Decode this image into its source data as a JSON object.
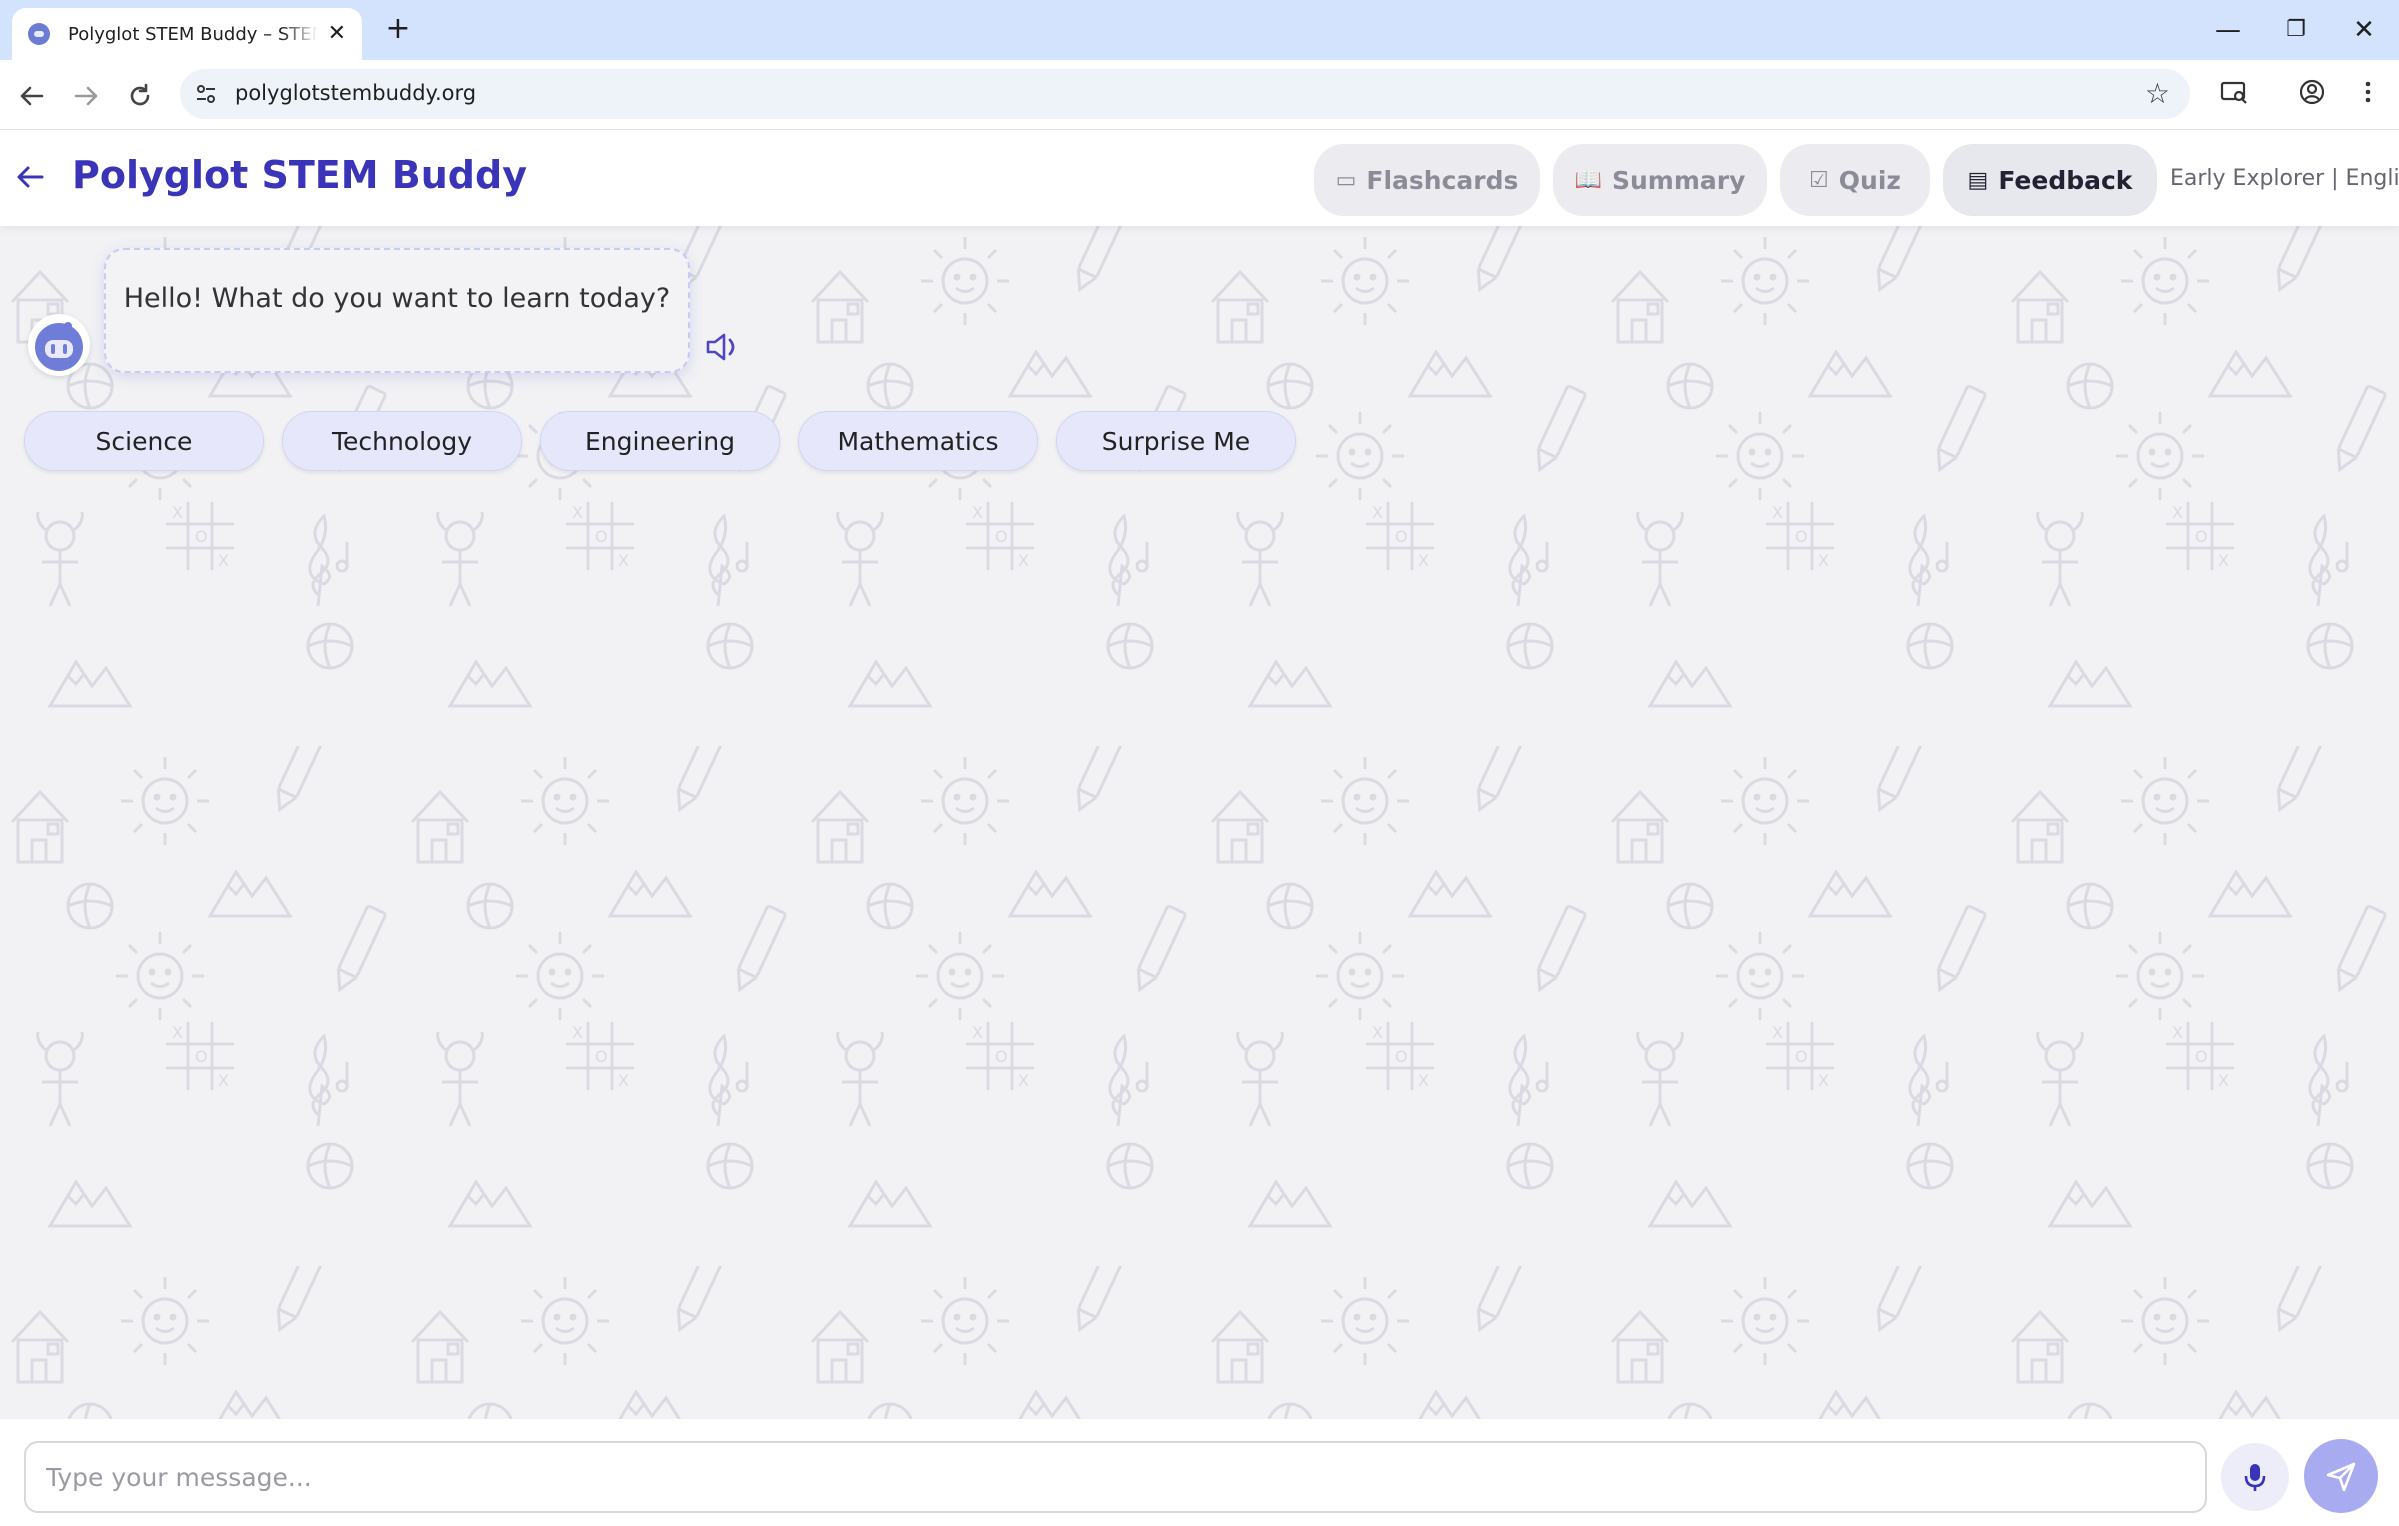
{
  "browser": {
    "tab_title": "Polyglot STEM Buddy – STEM le",
    "tab_close": "✕",
    "new_tab": "+",
    "url": "polyglotstembuddy.org",
    "window_controls": {
      "minimize": "—",
      "restore": "❐",
      "close": "✕"
    }
  },
  "header": {
    "title": "Polyglot STEM Buddy",
    "nav": [
      {
        "label": "Flashcards",
        "icon": "cards-icon",
        "state": "disabled"
      },
      {
        "label": "Summary",
        "icon": "book-icon",
        "state": "disabled"
      },
      {
        "label": "Quiz",
        "icon": "clipboard-icon",
        "state": "disabled"
      },
      {
        "label": "Feedback",
        "icon": "feedback-icon",
        "state": "active"
      }
    ],
    "level_language": "Early Explorer | English"
  },
  "chat": {
    "greeting": "Hello! What do you want to learn today?"
  },
  "topics": [
    "Science",
    "Technology",
    "Engineering",
    "Mathematics",
    "Surprise Me"
  ],
  "composer": {
    "placeholder": "Type your message..."
  },
  "colors": {
    "brand": "#3a34b8",
    "topic_bg": "#e6e7fb",
    "send_bg": "#a8abf0"
  }
}
